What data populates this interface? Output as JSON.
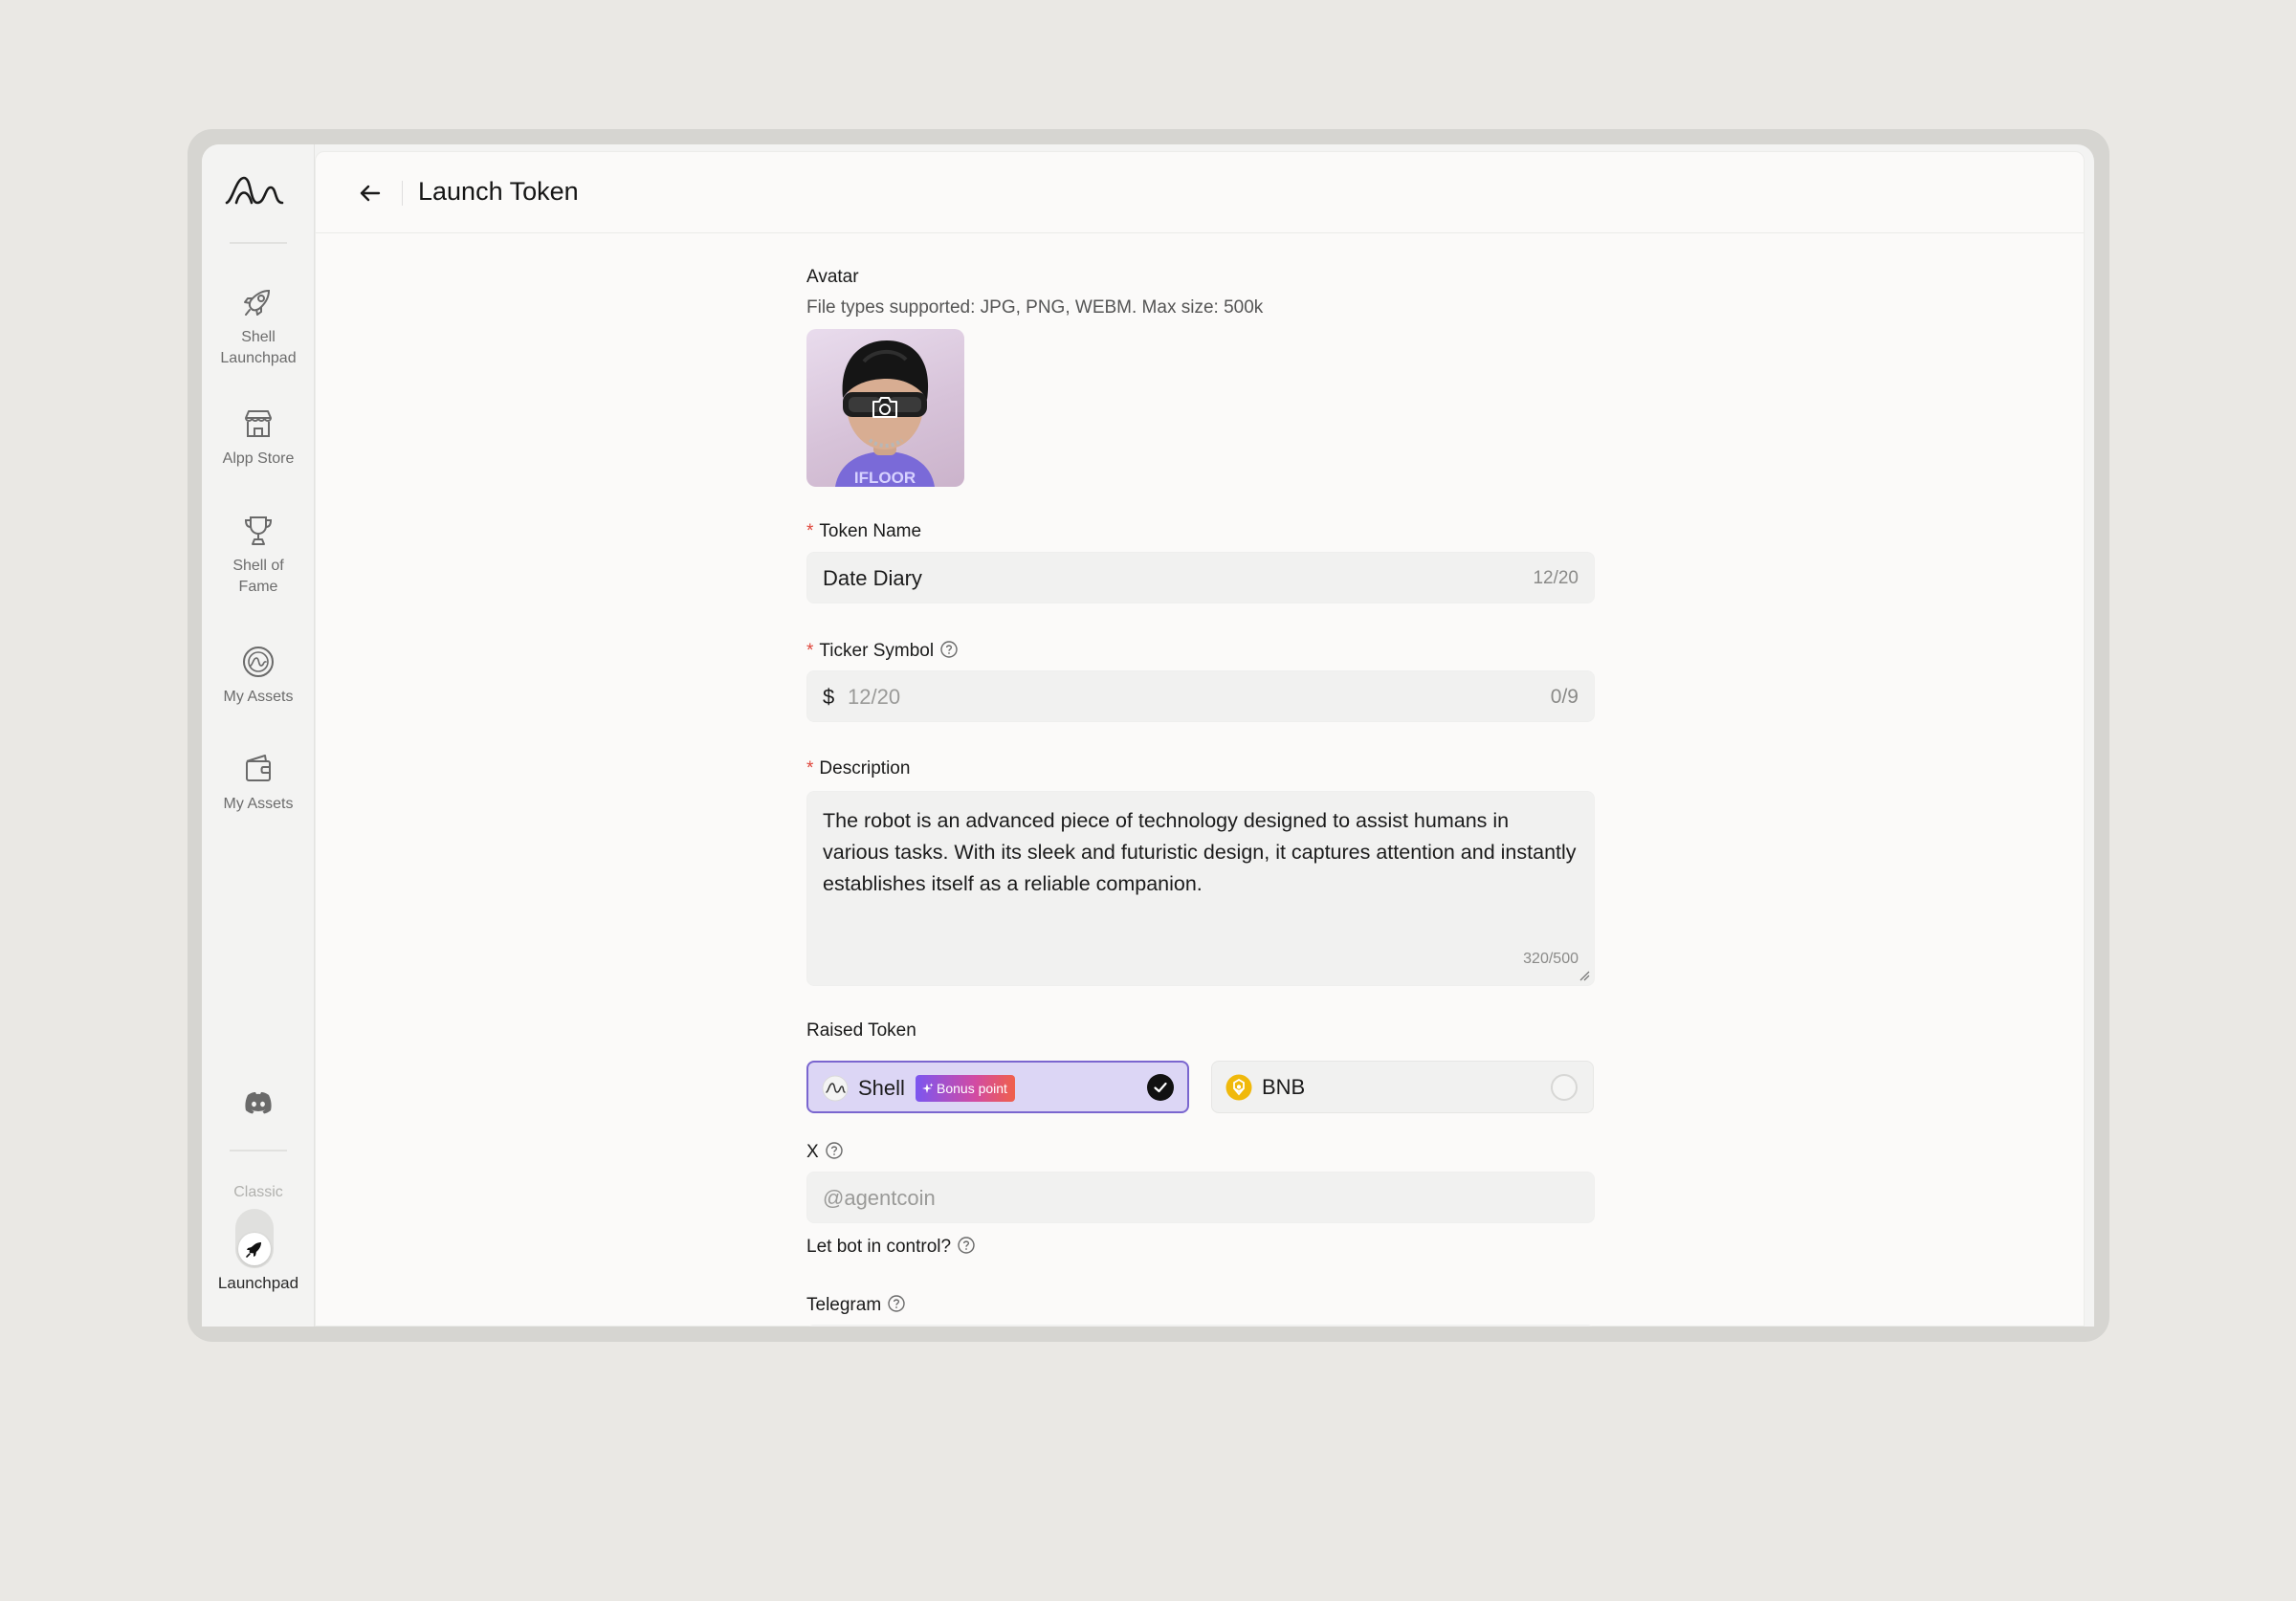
{
  "sidebar": {
    "items": [
      {
        "label_line1": "Shell",
        "label_line2": "Launchpad",
        "icon": "rocket-icon"
      },
      {
        "label_line1": "Alpp Store",
        "label_line2": "",
        "icon": "store-icon"
      },
      {
        "label_line1": "Shell of",
        "label_line2": "Fame",
        "icon": "trophy-icon"
      },
      {
        "label_line1": "My Assets",
        "label_line2": "",
        "icon": "assets-icon"
      },
      {
        "label_line1": "My Assets",
        "label_line2": "",
        "icon": "wallet-icon"
      }
    ],
    "discord_icon": "discord-icon",
    "mode_toggle": {
      "off_label": "Classic",
      "on_label": "Launchpad"
    }
  },
  "header": {
    "title": "Launch Token"
  },
  "form": {
    "avatar": {
      "label": "Avatar",
      "hint": "File types supported: JPG, PNG, WEBM. Max size: 500k",
      "shirt_text": "IFLOOR"
    },
    "token_name": {
      "label": "Token Name",
      "value": "Date Diary",
      "counter": "12/20"
    },
    "ticker": {
      "label": "Ticker Symbol",
      "prefix": "$",
      "placeholder": "12/20",
      "counter": "0/9"
    },
    "description": {
      "label": "Description",
      "value": "The robot is an advanced piece of technology designed to assist humans in various tasks. With its sleek and futuristic design, it captures attention and instantly establishes itself as a reliable companion.",
      "counter": "320/500"
    },
    "raised_token": {
      "label": "Raised Token",
      "options": [
        {
          "name": "Shell",
          "badge": "Bonus point",
          "selected": true
        },
        {
          "name": "BNB",
          "selected": false
        }
      ]
    },
    "x": {
      "label": "X",
      "placeholder": "@agentcoin"
    },
    "bot_control": {
      "label": "Let bot in control?"
    },
    "telegram": {
      "label": "Telegram"
    }
  },
  "colors": {
    "accent": "#7a66cf",
    "required": "#e0463c",
    "bnb": "#f0b90b"
  }
}
